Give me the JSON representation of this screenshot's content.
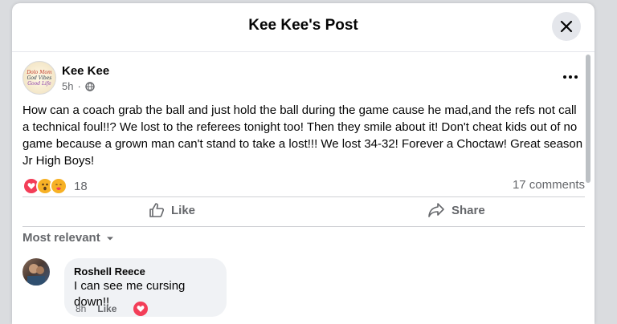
{
  "modal": {
    "title": "Kee Kee's Post"
  },
  "post": {
    "author": "Kee Kee",
    "time": "5h",
    "page_logo_text": [
      "Dolo Mom",
      "God Vibes",
      "Good Life"
    ],
    "text": "How can a coach grab the ball and just hold the ball during the game cause he mad,and the refs not call a technical foul!!? We lost to the referees tonight too! Then they smile about it! Don't cheat kids out of no game because a grown man can't stand to take a lost!!! We lost 34-32! Forever a Choctaw! Great season Jr High Boys!",
    "reaction_count": "18",
    "reactions": [
      "love",
      "wow",
      "care"
    ],
    "comments_count": "17 comments"
  },
  "actions": {
    "like": "Like",
    "share": "Share"
  },
  "comments_sort": "Most relevant",
  "comments": [
    {
      "name": "Roshell Reece",
      "text": "I can see me cursing down!!",
      "time": "8h",
      "like_label": "Like",
      "reaction": "love"
    }
  ],
  "colors": {
    "secondary_text": "#65676b",
    "love": "#f33e58",
    "wow": "#f7b125",
    "bubble": "#f0f2f5"
  }
}
